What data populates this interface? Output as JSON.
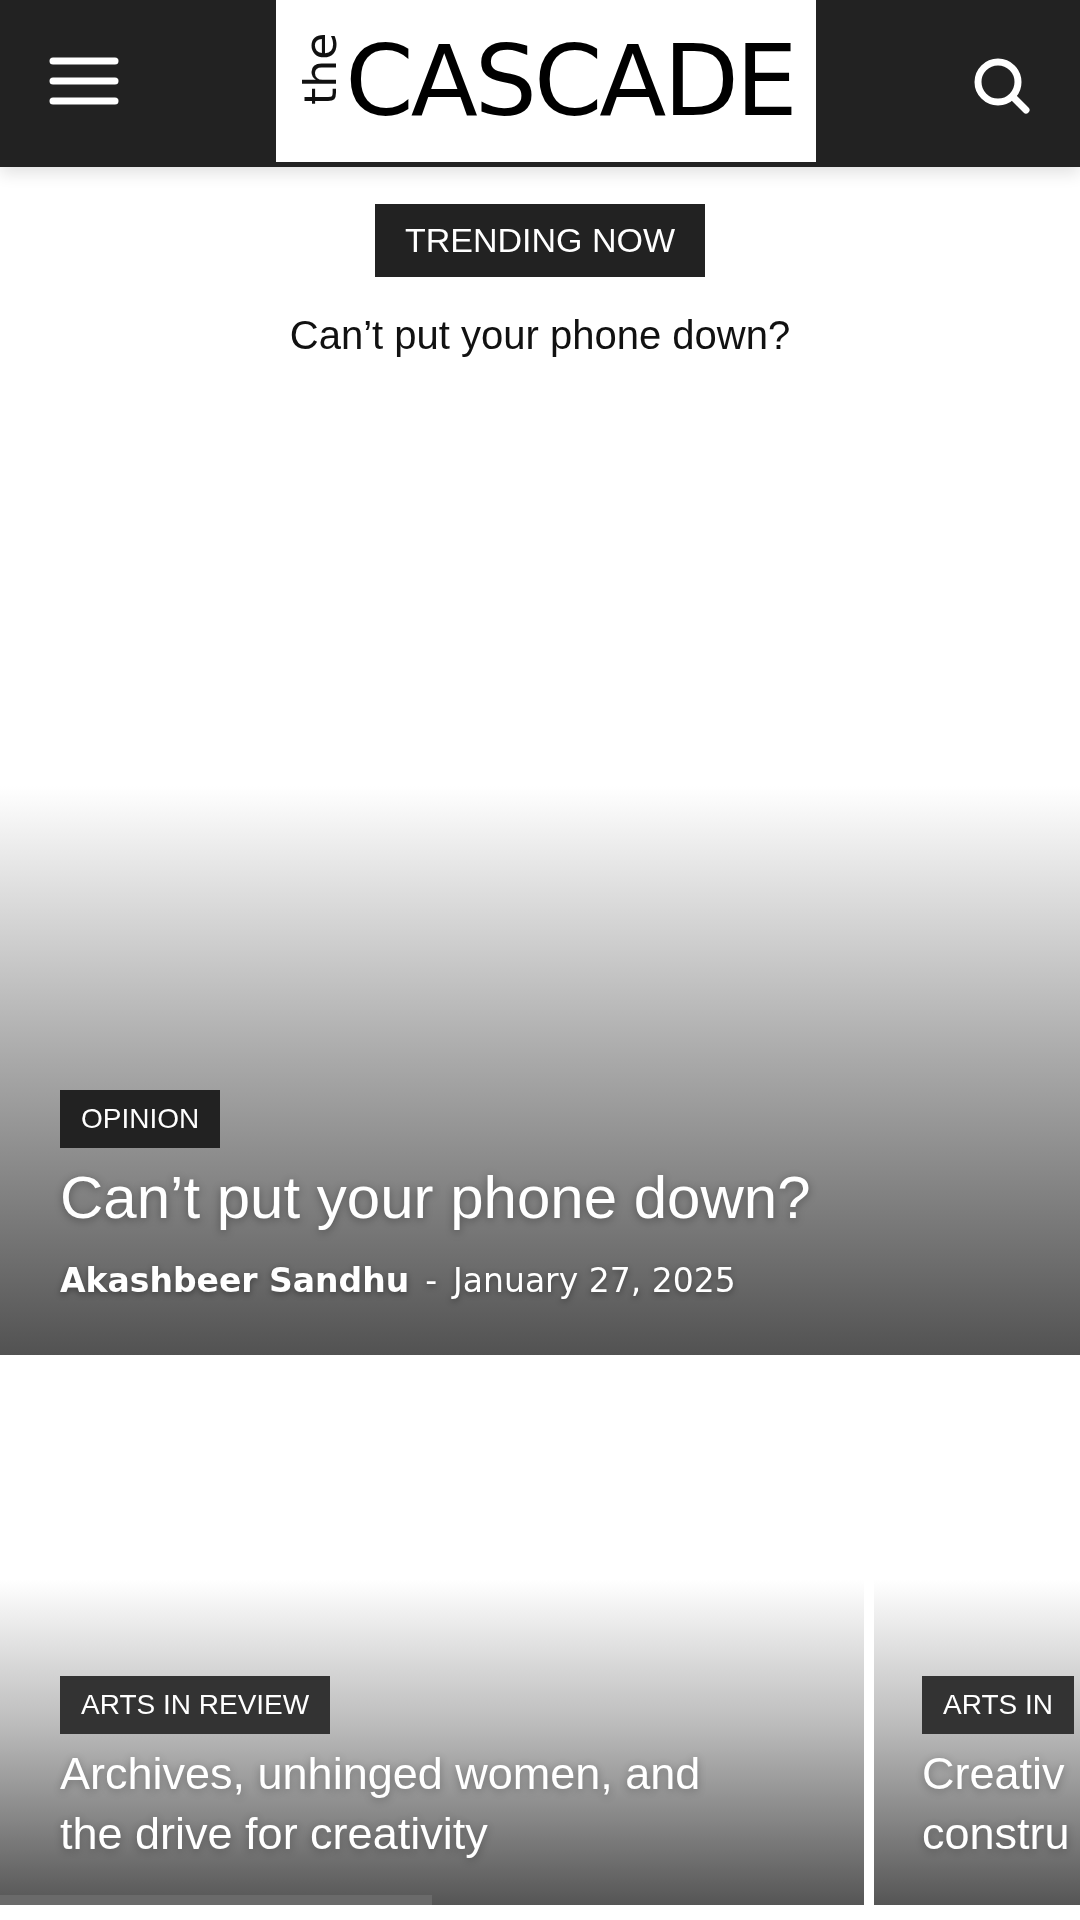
{
  "header": {
    "logo_prefix": "the",
    "logo": "CASCADE"
  },
  "trending": {
    "label": "TRENDING NOW",
    "headline": "Can’t put your phone down?"
  },
  "hero": {
    "category": "OPINION",
    "title": "Can’t put your phone down?",
    "author": "Akashbeer Sandhu",
    "separator": "-",
    "date": "January 27, 2025"
  },
  "slider": {
    "cards": [
      {
        "category": "ARTS IN REVIEW",
        "title_lines": [
          "Archives, unhinged women, and",
          "the drive for creativity"
        ]
      },
      {
        "category": "ARTS IN",
        "title_lines": [
          "Creativ",
          "constru"
        ]
      }
    ]
  }
}
